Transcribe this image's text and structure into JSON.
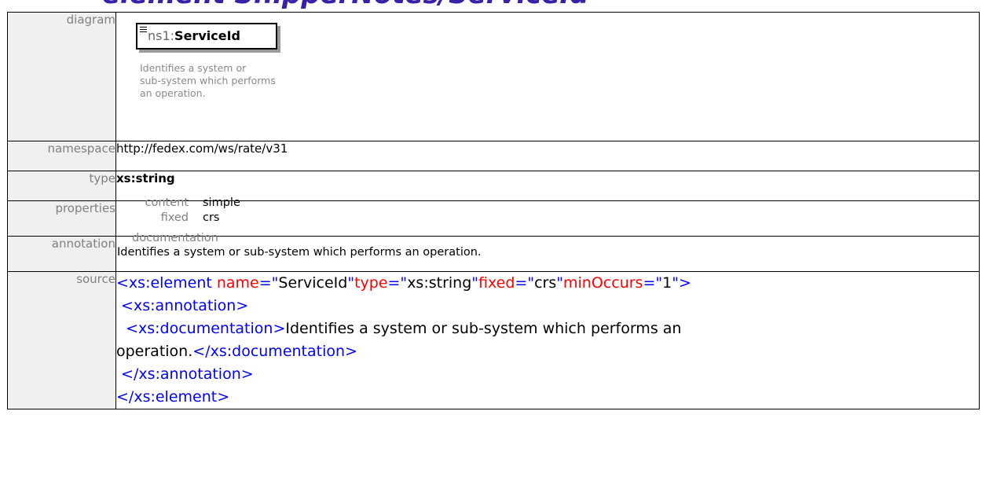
{
  "heading": "element ShipperNotes/ServiceId",
  "rows": {
    "diagram": {
      "label": "diagram",
      "box": {
        "prefix": "ns1:",
        "name": "ServiceId"
      },
      "doc_lines": [
        "Identifies a system or",
        "sub-system which performs",
        "an operation."
      ]
    },
    "namespace": {
      "label": "namespace",
      "value": "http://fedex.com/ws/rate/v31"
    },
    "type": {
      "label": "type",
      "value": "xs:string"
    },
    "properties": {
      "label": "properties",
      "items": [
        {
          "key": "content",
          "value": "simple"
        },
        {
          "key": "fixed",
          "value": "crs"
        }
      ]
    },
    "annotation": {
      "label": "annotation",
      "head": "documentation",
      "text": "Identifies a system or sub-system which  performs an operation."
    },
    "source": {
      "label": "source",
      "line1": {
        "open": "<xs:element",
        "a1_name": " name",
        "a1_eq": "=\"",
        "a1_val": "ServiceId",
        "a1_end": "\"",
        "a2_name": "type",
        "a2_eq": "=\"",
        "a2_val": "xs:string",
        "a2_end": "\"",
        "a3_name": "fixed",
        "a3_eq": "=\"",
        "a3_val": "crs",
        "a3_end": "\"",
        "a4_name": "minOccurs",
        "a4_eq": "=\"",
        "a4_val": "1",
        "a4_end": "\"",
        "close": ">"
      },
      "line2": " <xs:annotation>",
      "line3_open": "  <xs:documentation>",
      "line3_text": "Identifies a system or sub-system which performs an",
      "line4_text": "operation.",
      "line4_close": "</xs:documentation>",
      "line5": " </xs:annotation>",
      "line6": "</xs:element>"
    }
  }
}
